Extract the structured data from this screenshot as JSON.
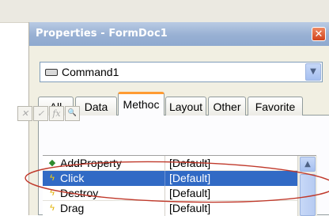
{
  "window": {
    "title": "Properties - FormDoc1",
    "close_glyph": "✕"
  },
  "object_selector": {
    "value": "Command1",
    "icon": "command-button-icon",
    "dropdown_glyph": "▼"
  },
  "tabs": [
    {
      "label": "All",
      "active": false
    },
    {
      "label": "Data",
      "active": false
    },
    {
      "label": "Methoc",
      "active": true
    },
    {
      "label": "Layout",
      "active": false
    },
    {
      "label": "Other",
      "active": false
    },
    {
      "label": "Favorite",
      "active": false
    }
  ],
  "toolbar": {
    "buttons": [
      {
        "name": "cancel-icon",
        "glyph": "✕"
      },
      {
        "name": "accept-icon",
        "glyph": "✓"
      },
      {
        "name": "function-icon",
        "glyph": "fx"
      },
      {
        "name": "zoom-icon",
        "glyph": "🔍"
      }
    ]
  },
  "property_rows": [
    {
      "name": "AddProperty",
      "value": "[Default]",
      "icon": "method-icon",
      "icon_color": "#2e8b2e",
      "selected": false
    },
    {
      "name": "Click",
      "value": "[Default]",
      "icon": "event-bolt-icon",
      "icon_color": "#e0b000",
      "selected": true
    },
    {
      "name": "Destroy",
      "value": "[Default]",
      "icon": "event-bolt-icon",
      "icon_color": "#e0b000",
      "selected": false
    },
    {
      "name": "Drag",
      "value": "[Default]",
      "icon": "event-bolt-icon",
      "icon_color": "#e0b000",
      "selected": false
    }
  ],
  "scrollbar": {
    "up_glyph": "▲"
  },
  "colors": {
    "selection": "#316ac5",
    "annotation": "#c0392b",
    "active_tab_accent": "#ff9b33"
  }
}
